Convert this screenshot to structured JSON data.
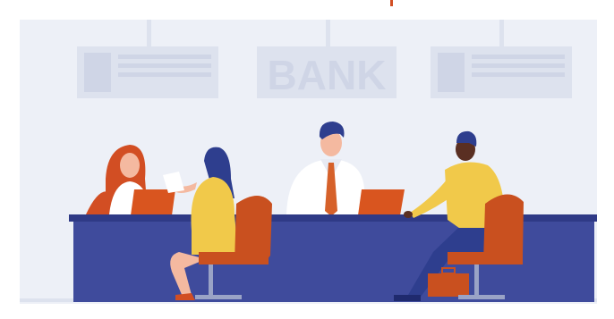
{
  "illustration": {
    "sign_center_text": "BANK"
  },
  "colors": {
    "backdrop": "#edf0f7",
    "sign_panel": "#dde2ee",
    "sign_detail": "#cfd5e6",
    "counter": "#3f4b9c",
    "counter_top": "#2f3a86",
    "laptop": "#d9551f",
    "chair": "#c9501f",
    "client_shirt": "#f1c94a",
    "teller_shirt": "#ffffff",
    "tie": "#d6612a",
    "hair_dark": "#2e3e8e",
    "hair_red": "#d24e23",
    "skin": "#f4b9a0"
  }
}
